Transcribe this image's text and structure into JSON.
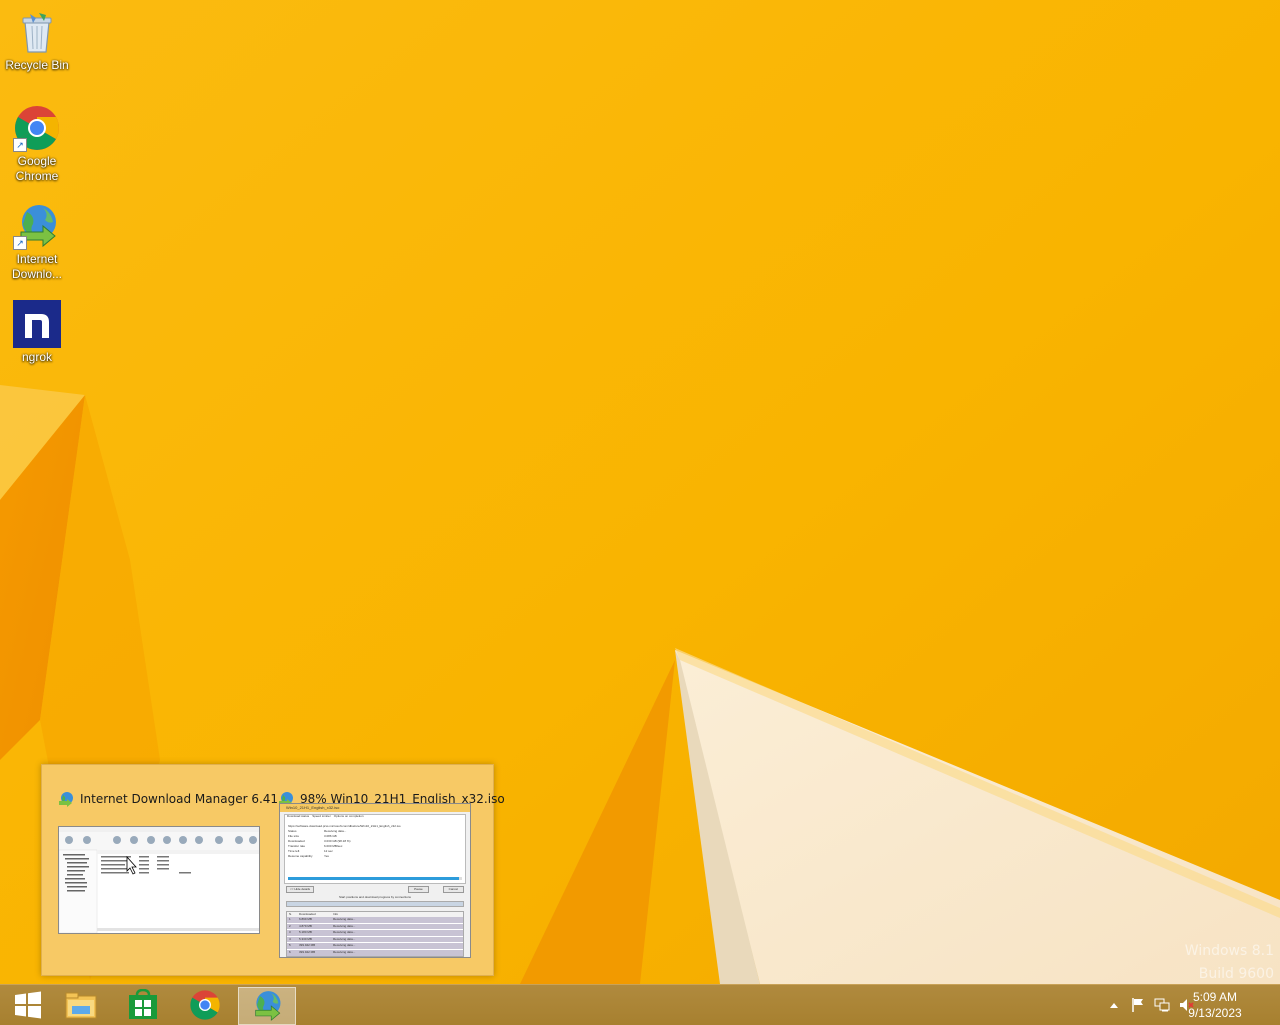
{
  "desktop": {
    "icons": [
      {
        "label": "Recycle Bin"
      },
      {
        "label": "Google Chrome"
      },
      {
        "label": "Internet Downlo..."
      },
      {
        "label": "ngrok"
      }
    ],
    "watermark": {
      "line1": "Windows 8.1",
      "line2": "Build 9600"
    }
  },
  "thumbnail_popup": {
    "items": [
      {
        "title": "Internet Download Manager 6.41"
      },
      {
        "title": "98% Win10_21H1_English_x32.iso",
        "window_title": "Win10_21H1_English_x32.iso",
        "tabs": [
          "Download status",
          "Speed Limiter",
          "Options on completion"
        ],
        "url": "https://software.download.prss.microsoft.com/dbazure/Win10_21H1_English_x32.iso",
        "status_rows": [
          {
            "label": "Status",
            "value": "Receiving data..."
          },
          {
            "label": "File size",
            "value": "3.086 GB"
          },
          {
            "label": "Downloaded",
            "value": "3.030 GB (98.18 %)"
          },
          {
            "label": "Transfer rate",
            "value": "6.000 MB/sec"
          },
          {
            "label": "Time left",
            "value": "12 sec"
          },
          {
            "label": "Resume capability",
            "value": "Yes"
          }
        ],
        "buttons": {
          "hide_details": "<< Hide details",
          "pause": "Pause",
          "cancel": "Cancel"
        },
        "connections_label": "Start positions and download progress by connections",
        "columns": [
          "N.",
          "Downloaded",
          "Info"
        ],
        "connections": [
          {
            "n": "1",
            "downloaded": "6.899 MB",
            "info": "Receiving data..."
          },
          {
            "n": "2",
            "downloaded": "4.879 MB",
            "info": "Receiving data..."
          },
          {
            "n": "3",
            "downloaded": "5.180 MB",
            "info": "Receiving data..."
          },
          {
            "n": "4",
            "downloaded": "5.330 MB",
            "info": "Receiving data..."
          },
          {
            "n": "5",
            "downloaded": "399.942 MB",
            "info": "Receiving data..."
          },
          {
            "n": "6",
            "downloaded": "399.942 MB",
            "info": "Receiving data..."
          }
        ]
      }
    ]
  },
  "taskbar": {
    "buttons": [
      {
        "name": "start"
      },
      {
        "name": "file-explorer"
      },
      {
        "name": "store"
      },
      {
        "name": "chrome"
      },
      {
        "name": "idm",
        "active": true
      }
    ],
    "clock": {
      "time": "5:09 AM",
      "date": "9/13/2023"
    }
  },
  "colors": {
    "wallpaper": "#f9b500",
    "taskbar": "#a7802f",
    "popup": "#f6cb6e"
  }
}
